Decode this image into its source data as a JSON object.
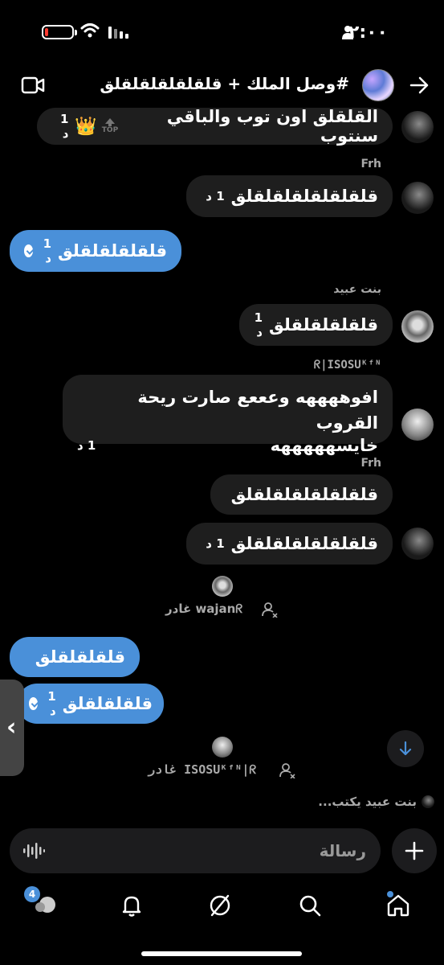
{
  "status_bar": {
    "time": "٢:٠٠"
  },
  "header": {
    "title": "#وصل الملك + قلقلقلقلقلقلق"
  },
  "messages": [
    {
      "text": "القلقلق اون توب والباقي سنتوب",
      "time": "1 د",
      "top_label": "TOP",
      "emoji": "👑"
    },
    {
      "sender": "Frh",
      "text": "قلقلقلقلقلقلقلق",
      "time": "1 د"
    },
    {
      "text": "قلقلقلقلقلق",
      "time": "1 د"
    },
    {
      "sender": "بنت عبيد",
      "text": "قلقلقلقلقلق",
      "time": "1 د"
    },
    {
      "sender": "ᖇ|ISOSUᴷᶠᴺ",
      "text_line1": "افوههههه وعععع صارت ريحة القروب",
      "text_line2": "خايسهههههه",
      "time": "1 د"
    },
    {
      "sender": "Frh",
      "text": "قلقلقلقلقلقلقلق"
    },
    {
      "text": "قلقلقلقلقلقلقلق",
      "time": "1 د"
    },
    {
      "text": "قلقلقلقلق"
    },
    {
      "text": "قلقلقلقلق",
      "time": "1 د"
    }
  ],
  "system": [
    {
      "text": "wajanᖇ غادر"
    },
    {
      "text": "ISOSUᴷᶠᴺ|ᖇ غادر"
    }
  ],
  "typing": "بنت عبيد يكتب...",
  "composer": {
    "placeholder": "رسالة"
  },
  "nav": {
    "messages_badge": "4"
  }
}
